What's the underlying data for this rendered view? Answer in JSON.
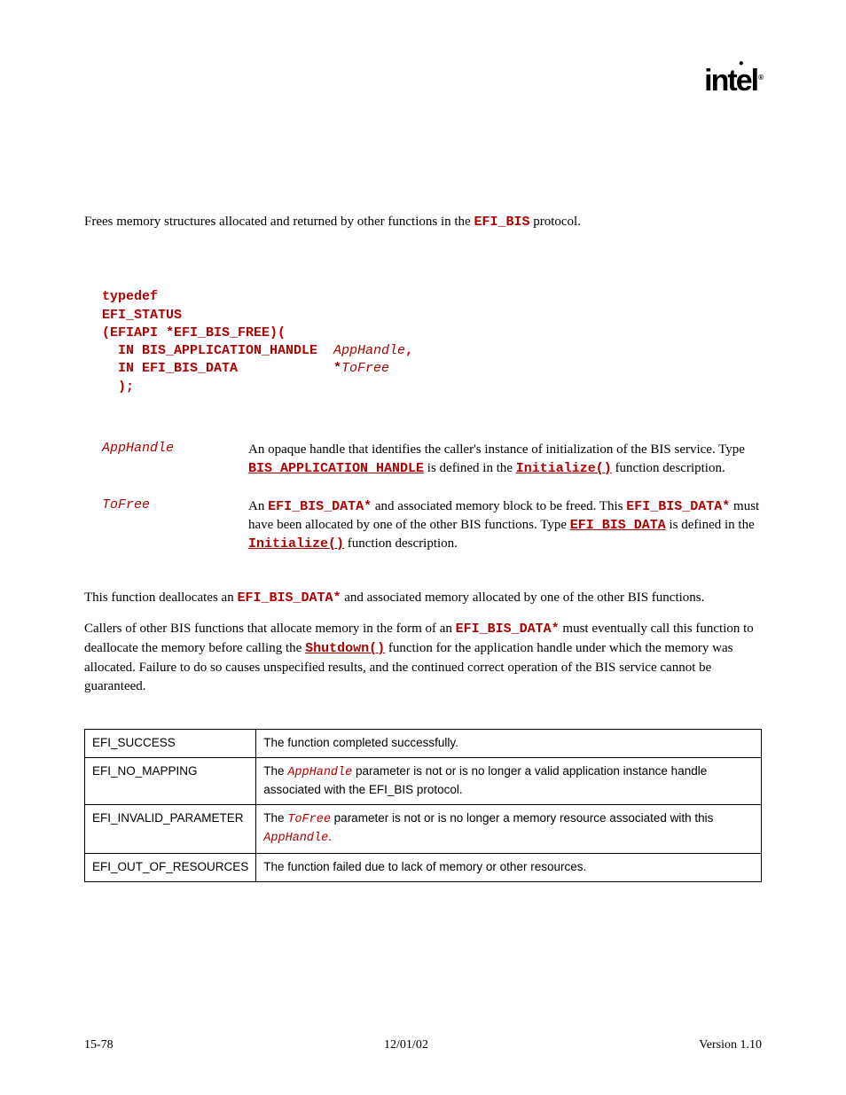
{
  "brand": "intel",
  "summary_pre": "Frees memory structures allocated and returned by other functions in the ",
  "summary_code": "EFI_BIS",
  "summary_post": " protocol.",
  "prototype": {
    "l1": "typedef",
    "l2": "EFI_STATUS",
    "l3": "(EFIAPI *EFI_BIS_FREE)(",
    "l4a": "  IN BIS_APPLICATION_HANDLE  ",
    "l4b": "AppHandle",
    "l4c": ",",
    "l5a": "  IN EFI_BIS_DATA            *",
    "l5b": "ToFree",
    "l6": "  );"
  },
  "params": {
    "p1": {
      "name": "AppHandle",
      "t1": "An opaque handle that identifies the caller's instance of initialization of the BIS service.  Type ",
      "c1": "BIS_APPLICATION_HANDLE",
      "t2": " is defined in the ",
      "c2": "Initialize()",
      "t3": " function description."
    },
    "p2": {
      "name": "ToFree",
      "t1": "An ",
      "c1": "EFI_BIS_DATA*",
      "t2": " and associated memory block to be freed.  This ",
      "c2": "EFI_BIS_DATA*",
      "t3": " must have been allocated by one of the other BIS functions.  Type ",
      "c3": "EFI_BIS_DATA",
      "t4": " is defined in the ",
      "c4": "Initialize()",
      "t5": " function description."
    }
  },
  "desc": {
    "p1a": "This function deallocates an ",
    "p1b": "EFI_BIS_DATA*",
    "p1c": " and associated memory allocated by one of the other BIS functions.",
    "p2a": "Callers of other BIS functions that allocate memory in the form of an ",
    "p2b": "EFI_BIS_DATA*",
    "p2c": " must eventually call this function to deallocate the memory before calling the ",
    "p2d": "Shutdown()",
    "p2e": " function for the application handle under which the memory was allocated.  Failure to do so causes unspecified results, and the continued correct operation of the BIS service cannot be guaranteed."
  },
  "status": {
    "r1": {
      "code": "EFI_SUCCESS",
      "t1": "The function completed successfully."
    },
    "r2": {
      "code": "EFI_NO_MAPPING",
      "t1": "The ",
      "c1": "AppHandle",
      "t2": " parameter is not or is no longer a valid application instance handle associated with the EFI_BIS protocol."
    },
    "r3": {
      "code": "EFI_INVALID_PARAMETER",
      "t1": "The ",
      "c1": "ToFree",
      "t2": " parameter is not or is no longer a memory resource associated with this ",
      "c2": "AppHandle",
      "t3": "."
    },
    "r4": {
      "code": "EFI_OUT_OF_RESOURCES",
      "t1": "The function failed due to lack of memory or other resources."
    }
  },
  "footer": {
    "left": "15-78",
    "center": "12/01/02",
    "right": "Version 1.10"
  }
}
